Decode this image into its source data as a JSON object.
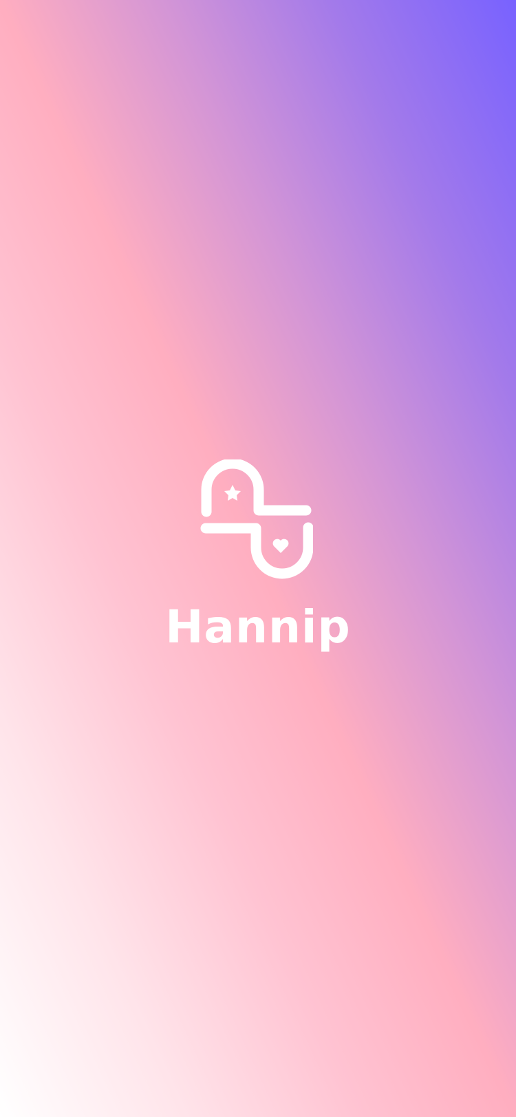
{
  "app": {
    "name": "Hannip",
    "logo_icon": "hannip-logo-icon",
    "colors": {
      "gradient_top_right": "#7862ff",
      "gradient_middle": "#ffaec0",
      "gradient_bottom_left": "#ffffff",
      "foreground": "#ffffff"
    }
  }
}
